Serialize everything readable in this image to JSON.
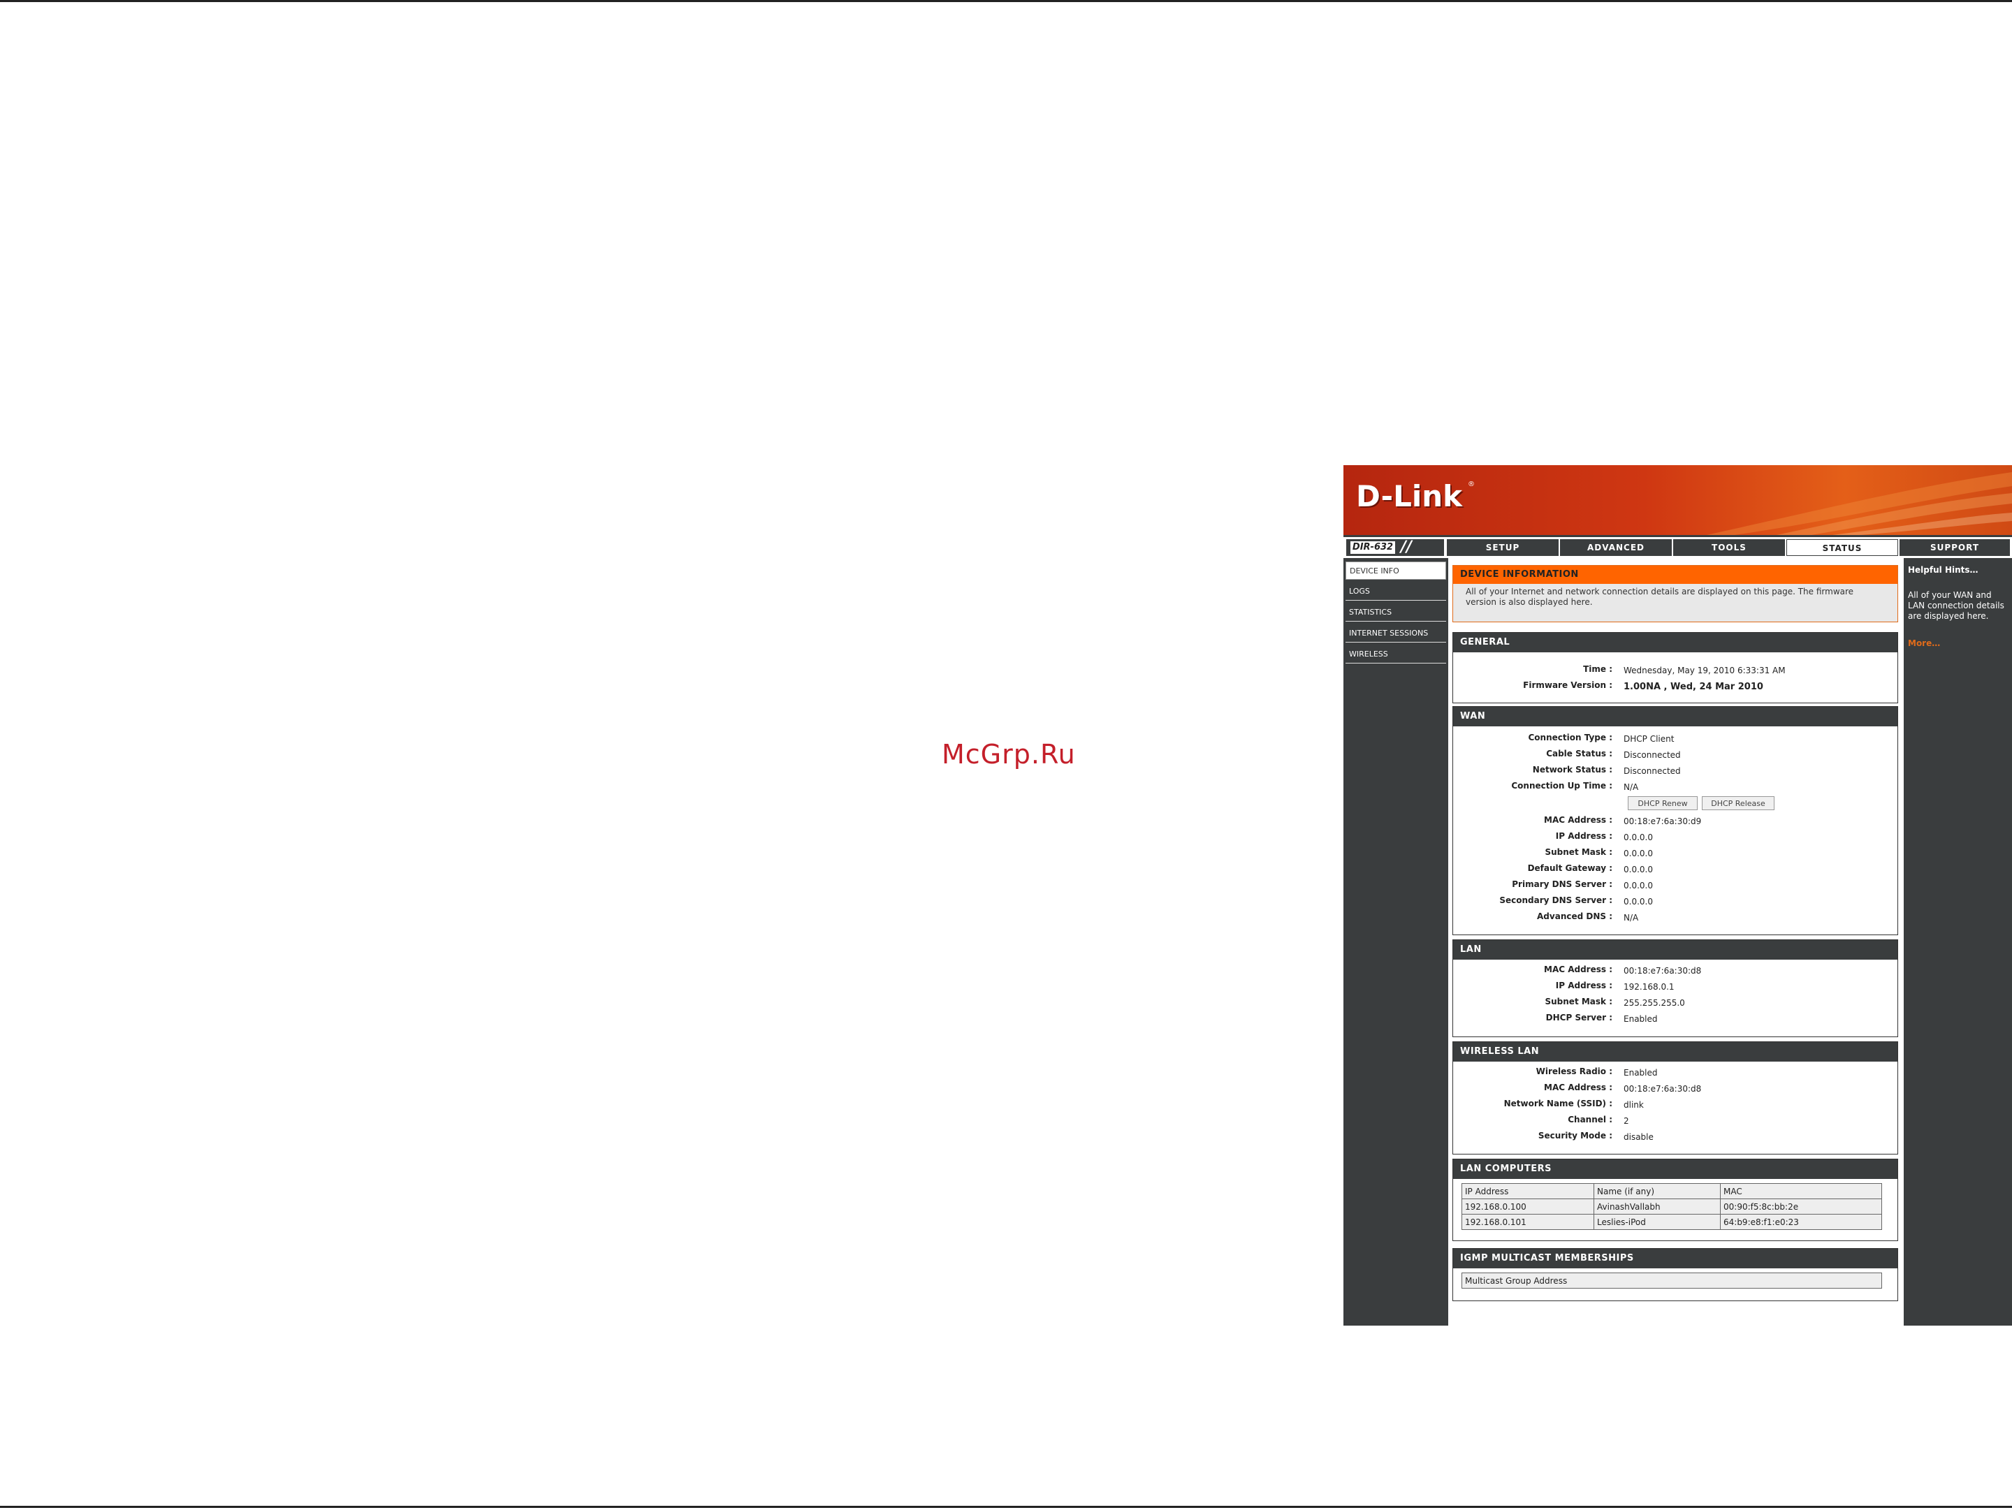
{
  "watermark": "McGrp.Ru",
  "brand": {
    "logo": "D-Link",
    "model": "DIR-632"
  },
  "tabs": [
    {
      "label": "SETUP"
    },
    {
      "label": "ADVANCED"
    },
    {
      "label": "TOOLS"
    },
    {
      "label": "STATUS",
      "active": true
    },
    {
      "label": "SUPPORT"
    }
  ],
  "sidebar": {
    "items": [
      {
        "label": "DEVICE INFO",
        "active": true
      },
      {
        "label": "LOGS"
      },
      {
        "label": "STATISTICS"
      },
      {
        "label": "INTERNET SESSIONS"
      },
      {
        "label": "WIRELESS"
      }
    ]
  },
  "device_info": {
    "title": "DEVICE INFORMATION",
    "text": "All of your Internet and network connection details are displayed on this page. The firmware version is also displayed here."
  },
  "general": {
    "title": "GENERAL",
    "time_label": "Time :",
    "time": "Wednesday, May 19, 2010 6:33:31 AM",
    "firmware_label": "Firmware Version :",
    "firmware": "1.00NA , Wed, 24 Mar 2010"
  },
  "wan": {
    "title": "WAN",
    "rows1": [
      {
        "label": "Connection Type :",
        "value": "DHCP Client"
      },
      {
        "label": "Cable Status :",
        "value": "Disconnected"
      },
      {
        "label": "Network Status :",
        "value": "Disconnected"
      },
      {
        "label": "Connection Up Time :",
        "value": "N/A"
      }
    ],
    "renew_button": "DHCP Renew",
    "release_button": "DHCP Release",
    "rows2": [
      {
        "label": "MAC Address :",
        "value": "00:18:e7:6a:30:d9"
      },
      {
        "label": "IP Address :",
        "value": "0.0.0.0"
      },
      {
        "label": "Subnet Mask :",
        "value": "0.0.0.0"
      },
      {
        "label": "Default Gateway :",
        "value": "0.0.0.0"
      },
      {
        "label": "Primary DNS Server :",
        "value": "0.0.0.0"
      },
      {
        "label": "Secondary DNS Server :",
        "value": "0.0.0.0"
      },
      {
        "label": "Advanced DNS :",
        "value": "N/A"
      }
    ]
  },
  "lan": {
    "title": "LAN",
    "rows": [
      {
        "label": "MAC Address :",
        "value": "00:18:e7:6a:30:d8"
      },
      {
        "label": "IP Address :",
        "value": "192.168.0.1"
      },
      {
        "label": "Subnet Mask :",
        "value": "255.255.255.0"
      },
      {
        "label": "DHCP Server :",
        "value": "Enabled"
      }
    ]
  },
  "wireless_lan": {
    "title": "WIRELESS LAN",
    "rows": [
      {
        "label": "Wireless Radio :",
        "value": "Enabled"
      },
      {
        "label": "MAC Address :",
        "value": "00:18:e7:6a:30:d8"
      },
      {
        "label": "Network Name (SSID) :",
        "value": "dlink"
      },
      {
        "label": "Channel :",
        "value": "2"
      },
      {
        "label": "Security Mode :",
        "value": "disable"
      }
    ]
  },
  "lan_computers": {
    "title": "LAN COMPUTERS",
    "headers": [
      "IP Address",
      "Name (if any)",
      "MAC"
    ],
    "rows": [
      [
        "192.168.0.100",
        "AvinashVallabh",
        "00:90:f5:8c:bb:2e"
      ],
      [
        "192.168.0.101",
        "Leslies-iPod",
        "64:b9:e8:f1:e0:23"
      ]
    ]
  },
  "igmp": {
    "title": "IGMP MULTICAST MEMBERSHIPS",
    "header": "Multicast Group Address"
  },
  "hints": {
    "title": "Helpful Hints…",
    "text": "All of your WAN and LAN connection details are displayed here.",
    "more": "More…"
  },
  "colors": {
    "banner": "#cf3712",
    "accent": "#ff6400",
    "dark": "#3a3d3e",
    "link": "#e06b1a"
  }
}
